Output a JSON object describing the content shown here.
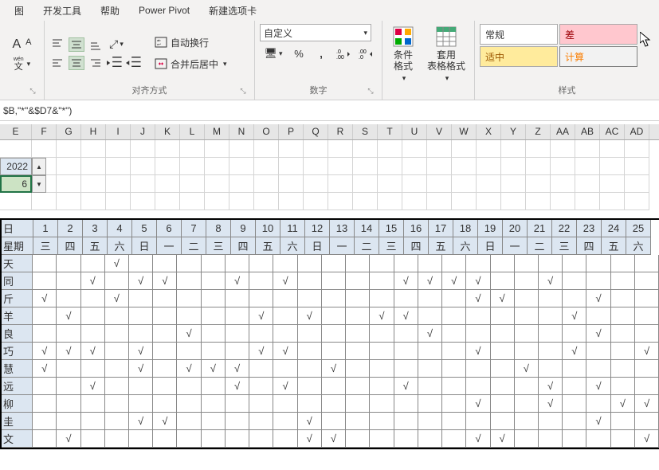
{
  "tabs": [
    "图",
    "开发工具",
    "帮助",
    "Power Pivot",
    "新建选项卡"
  ],
  "ribbon": {
    "alignment_label": "对齐方式",
    "number_label": "数字",
    "styles_label": "样式",
    "wrap_text": "自动换行",
    "merge_center": "合并后居中",
    "format_select": "自定义",
    "cond_fmt": "条件格式",
    "table_fmt": "套用\n表格格式",
    "style_normal": "常规",
    "style_bad": "差",
    "style_good": "适中",
    "style_calc": "计算",
    "wen": "文"
  },
  "formula": "$B,\"*\"&$D7&\"*\")",
  "cols": [
    "E",
    "F",
    "G",
    "H",
    "I",
    "J",
    "K",
    "L",
    "M",
    "N",
    "O",
    "P",
    "Q",
    "R",
    "S",
    "T",
    "U",
    "V",
    "W",
    "X",
    "Y",
    "Z",
    "AA",
    "AB",
    "AC",
    "AD"
  ],
  "year": "2022",
  "month": "6",
  "table": {
    "header1": [
      "日",
      "1",
      "2",
      "3",
      "4",
      "5",
      "6",
      "7",
      "8",
      "9",
      "10",
      "11",
      "12",
      "13",
      "14",
      "15",
      "16",
      "17",
      "18",
      "19",
      "20",
      "21",
      "22",
      "23",
      "24",
      "25"
    ],
    "header2": [
      "星期",
      "三",
      "四",
      "五",
      "六",
      "日",
      "一",
      "二",
      "三",
      "四",
      "五",
      "六",
      "日",
      "一",
      "二",
      "三",
      "四",
      "五",
      "六",
      "日",
      "一",
      "二",
      "三",
      "四",
      "五",
      "六"
    ],
    "rows": [
      {
        "name": "天",
        "data": [
          "",
          "",
          "",
          "√",
          "",
          "",
          "",
          "",
          "",
          "",
          "",
          "",
          "",
          "",
          "",
          "",
          "",
          "",
          "",
          "",
          "",
          "",
          "",
          "",
          "",
          ""
        ]
      },
      {
        "name": "同",
        "data": [
          "",
          "",
          "√",
          "",
          "√",
          "√",
          "",
          "",
          "√",
          "",
          "√",
          "",
          "",
          "",
          "",
          "√",
          "√",
          "√",
          "√",
          "",
          "",
          "√",
          "",
          "",
          "",
          ""
        ]
      },
      {
        "name": "斤",
        "data": [
          "√",
          "",
          "",
          "√",
          "",
          "",
          "",
          "",
          "",
          "",
          "",
          "",
          "",
          "",
          "",
          "",
          "",
          "",
          "√",
          "√",
          "",
          "",
          "",
          "√",
          "",
          ""
        ]
      },
      {
        "name": "羊",
        "data": [
          "",
          "√",
          "",
          "",
          "",
          "",
          "",
          "",
          "",
          "√",
          "",
          "√",
          "",
          "",
          "√",
          "√",
          "",
          "",
          "",
          "",
          "",
          "",
          "√",
          "",
          "",
          ""
        ]
      },
      {
        "name": "良",
        "data": [
          "",
          "",
          "",
          "",
          "",
          "",
          "√",
          "",
          "",
          "",
          "",
          "",
          "",
          "",
          "",
          "",
          "√",
          "",
          "",
          "",
          "",
          "",
          "",
          "√",
          "",
          ""
        ]
      },
      {
        "name": "巧",
        "data": [
          "√",
          "√",
          "√",
          "",
          "√",
          "",
          "",
          "",
          "",
          "√",
          "√",
          "",
          "",
          "",
          "",
          "",
          "",
          "",
          "√",
          "",
          "",
          "",
          "√",
          "",
          "",
          "√"
        ]
      },
      {
        "name": "慧",
        "data": [
          "√",
          "",
          "",
          "",
          "√",
          "",
          "√",
          "√",
          "√",
          "",
          "",
          "",
          "√",
          "",
          "",
          "",
          "",
          "",
          "",
          "",
          "√",
          "",
          "",
          "",
          "",
          ""
        ]
      },
      {
        "name": "远",
        "data": [
          "",
          "",
          "√",
          "",
          "",
          "",
          "",
          "",
          "√",
          "",
          "√",
          "",
          "",
          "",
          "",
          "√",
          "",
          "",
          "",
          "",
          "",
          "√",
          "",
          "√",
          "",
          ""
        ]
      },
      {
        "name": "柳",
        "data": [
          "",
          "",
          "",
          "",
          "",
          "",
          "",
          "",
          "",
          "",
          "",
          "",
          "",
          "",
          "",
          "",
          "",
          "",
          "√",
          "",
          "",
          "√",
          "",
          "",
          "√",
          "√"
        ]
      },
      {
        "name": "圭",
        "data": [
          "",
          "",
          "",
          "",
          "√",
          "√",
          "",
          "",
          "",
          "",
          "",
          "√",
          "",
          "",
          "",
          "",
          "",
          "",
          "",
          "",
          "",
          "",
          "",
          "√",
          "",
          ""
        ]
      },
      {
        "name": "文",
        "data": [
          "",
          "√",
          "",
          "",
          "",
          "",
          "",
          "",
          "",
          "",
          "",
          "√",
          "√",
          "",
          "",
          "",
          "",
          "",
          "√",
          "√",
          "",
          "",
          "",
          "",
          "",
          "√"
        ]
      }
    ]
  },
  "col_widths": {
    "E": 40,
    "other": 31
  }
}
